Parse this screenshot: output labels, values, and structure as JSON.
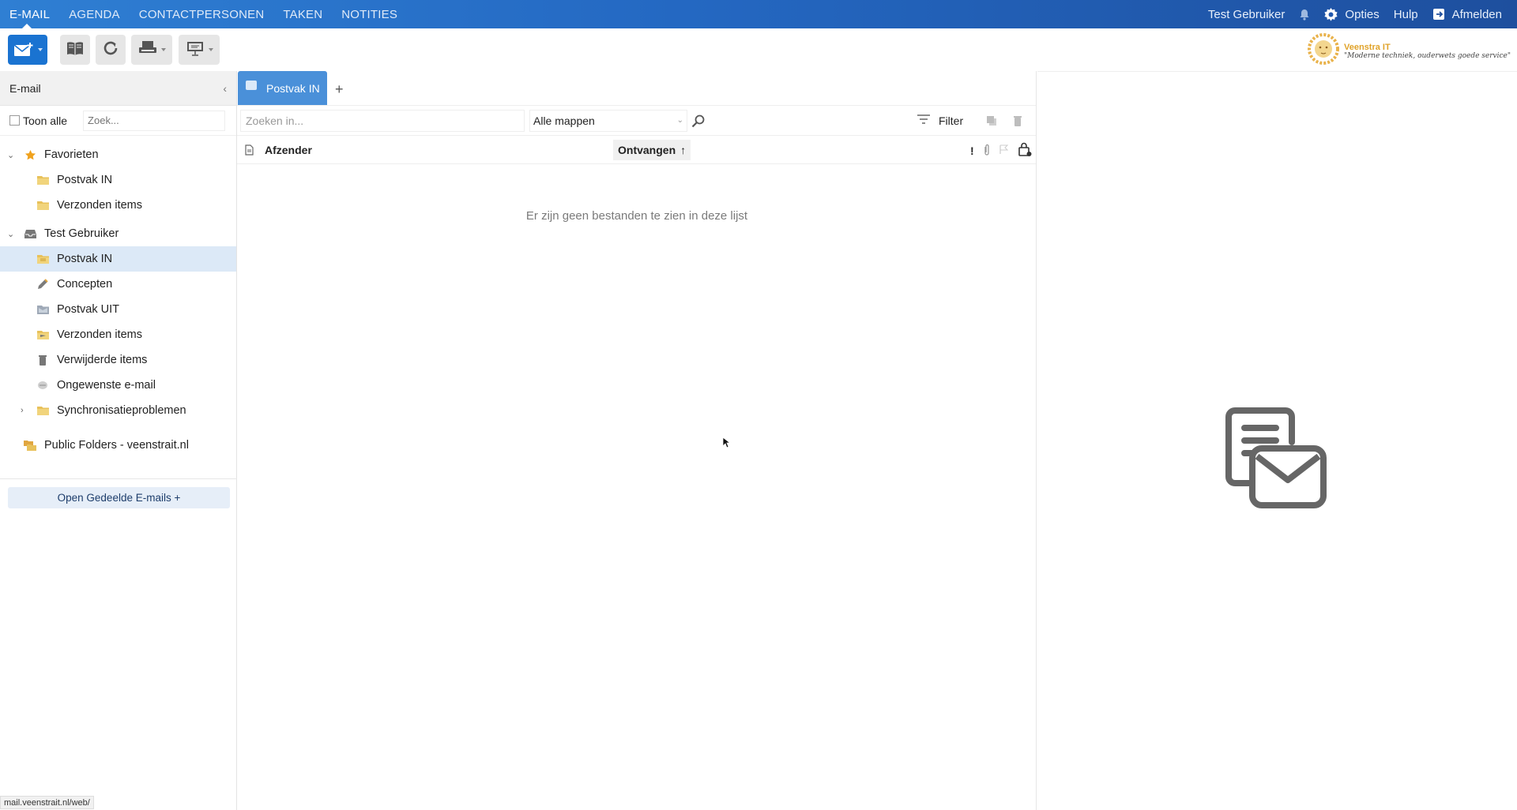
{
  "topnav": {
    "tabs": [
      "E-MAIL",
      "AGENDA",
      "CONTACTPERSONEN",
      "TAKEN",
      "NOTITIES"
    ],
    "user": "Test Gebruiker",
    "options": "Opties",
    "help": "Hulp",
    "logout": "Afmelden"
  },
  "logo": {
    "brand": "Veenstra IT",
    "slogan": "\"Moderne techniek, ouderwets goede service\""
  },
  "sidebar": {
    "title": "E-mail",
    "show_all": "Toon alle",
    "search_placeholder": "Zoek...",
    "favorites": "Favorieten",
    "fav_items": [
      "Postvak IN",
      "Verzonden items"
    ],
    "account": "Test Gebruiker",
    "folders": [
      "Postvak IN",
      "Concepten",
      "Postvak UIT",
      "Verzonden items",
      "Verwijderde items",
      "Ongewenste e-mail",
      "Synchronisatieproblemen"
    ],
    "public": "Public Folders - veenstrait.nl",
    "share_button": "Open Gedeelde E-mails +"
  },
  "list": {
    "tab": "Postvak IN",
    "search_placeholder": "Zoeken in...",
    "folder_scope": "Alle mappen",
    "filter": "Filter",
    "col_sender": "Afzender",
    "col_received": "Ontvangen",
    "importance": "!",
    "empty": "Er zijn geen bestanden te zien in deze lijst"
  },
  "statusbar": "mail.veenstrait.nl/web/",
  "colors": {
    "topbar": "#2468c2",
    "selected": "#dce9f7",
    "accent": "#1a73d1",
    "folder": "#e8c15a"
  }
}
